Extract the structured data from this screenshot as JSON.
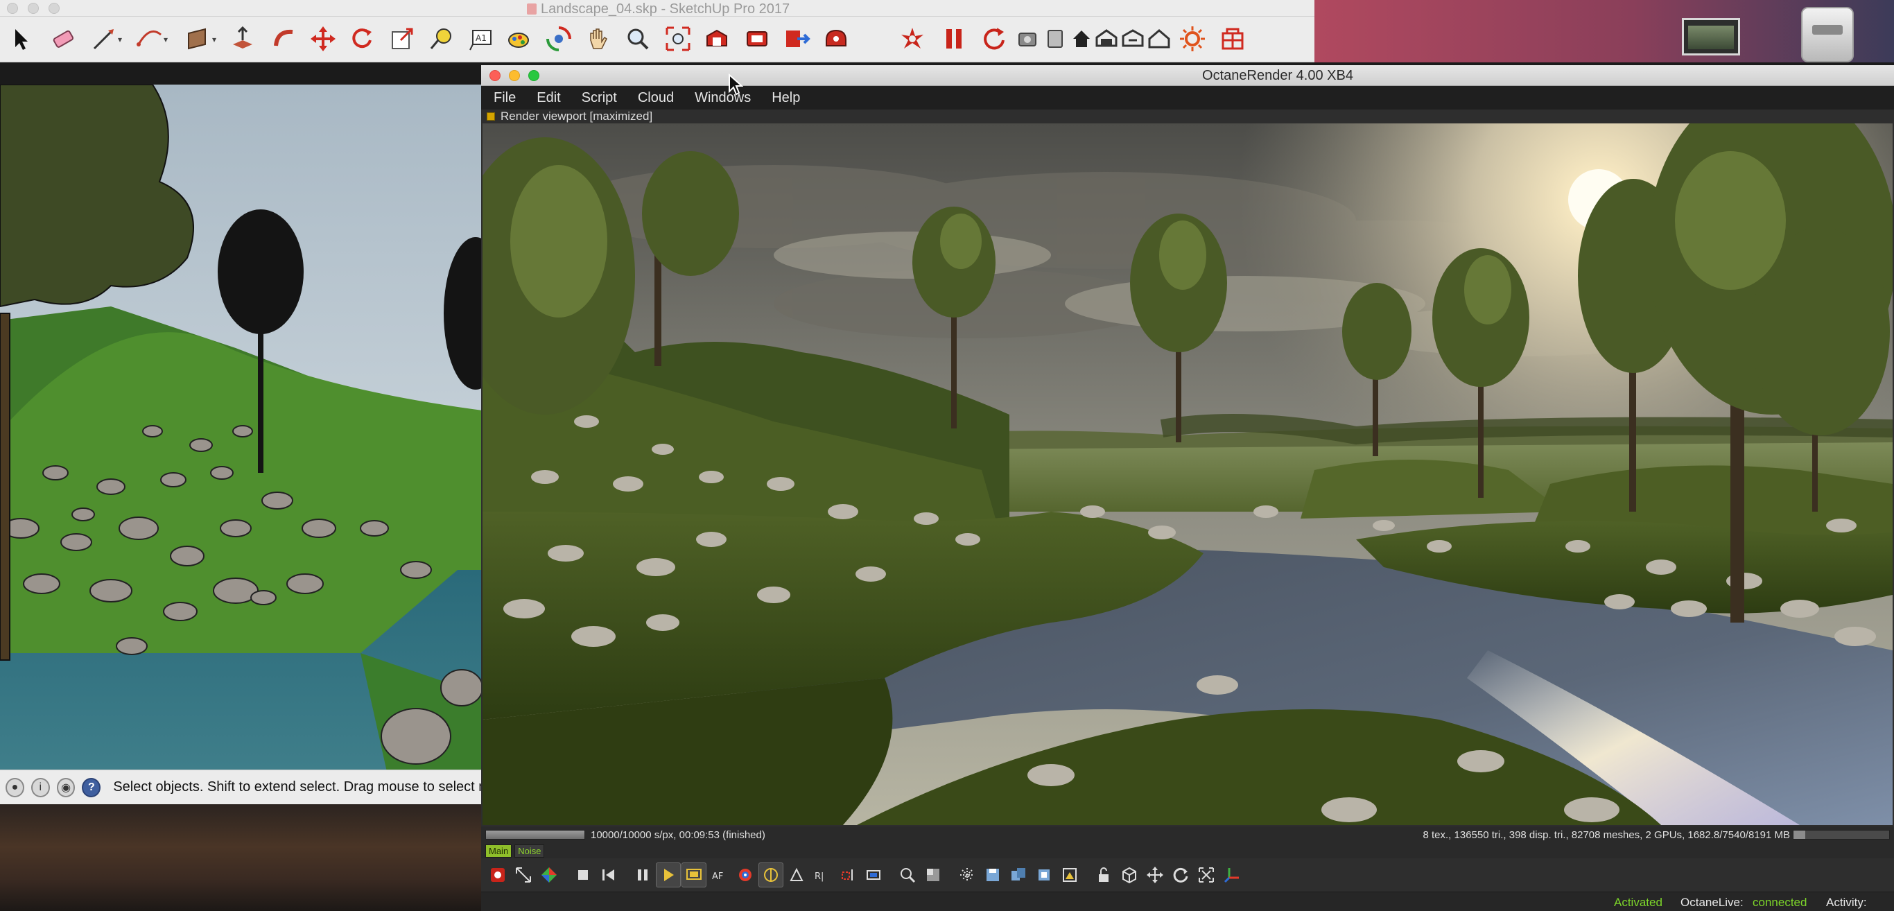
{
  "sketchup": {
    "window_title": "Landscape_04.skp - SketchUp Pro 2017",
    "toolbar_icons": [
      "select-arrow-icon",
      "eraser-icon",
      "pencil-line-icon",
      "arc-icon",
      "rectangle-icon",
      "push-pull-icon",
      "follow-me-icon",
      "move-icon",
      "rotate-icon",
      "scale-icon",
      "tape-measure-icon",
      "text-label-icon",
      "paint-bucket-icon",
      "orbit-icon",
      "pan-hand-icon",
      "zoom-icon",
      "zoom-extents-icon",
      "warehouse-icon",
      "extension-warehouse-icon",
      "send-to-layout-icon",
      "extension-manager-icon",
      "octane-logo-icon",
      "pause-render-icon",
      "restart-render-icon",
      "material-icon",
      "object-icon",
      "home-icon",
      "camera-icon",
      "render-settings-icon",
      "house-outline-icon",
      "sun-settings-icon",
      "component-icon"
    ],
    "status_text": "Select objects. Shift to extend select. Drag mouse to select multiple."
  },
  "octane": {
    "window_title": "OctaneRender 4.00 XB4",
    "menu": [
      "File",
      "Edit",
      "Script",
      "Cloud",
      "Windows",
      "Help"
    ],
    "viewport_title": "Render viewport [maximized]",
    "progress": 1.0,
    "render_info": "10000/10000 s/px, 00:09:53 (finished)",
    "scene_stats": "8 tex., 136550 tri., 398 disp. tri., 82708 meshes, 2 GPUs, 1682.8/7540/8191 MB",
    "tabs": [
      "Main",
      "Noise"
    ],
    "bottom": {
      "activated": "Activated",
      "octanelive_label": "OctaneLive:",
      "octanelive_status": "connected",
      "activity_label": "Activity:"
    }
  },
  "colors": {
    "accent_green": "#7dd62a",
    "octane_red": "#cc2a1e",
    "window_bg": "#2e2e2e"
  }
}
